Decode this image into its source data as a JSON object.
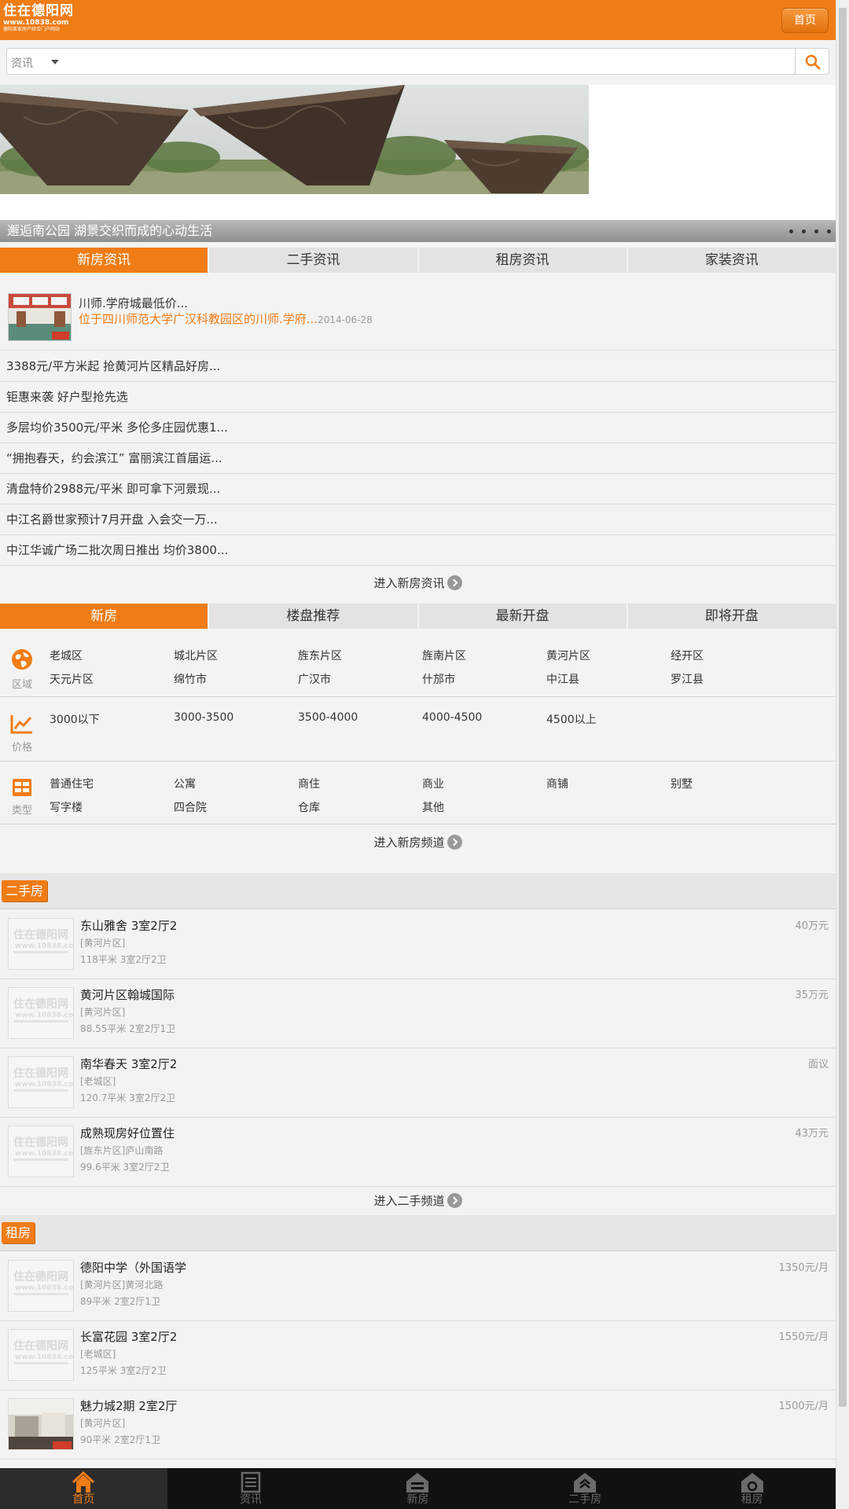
{
  "header": {
    "logo_line1": "住在德阳网",
    "logo_line2": "www.10838.com",
    "logo_line3": "德阳首家房产综合门户网站",
    "home_button": "首页"
  },
  "search": {
    "category": "资讯",
    "placeholder": ""
  },
  "banner": {
    "caption": "邂逅南公园 湖景交织而成的心动生活"
  },
  "news_tabs": [
    "新房资讯",
    "二手资讯",
    "租房资讯",
    "家装资讯"
  ],
  "news": {
    "featured": {
      "title": "川师.学府城最低价...",
      "desc": "位于四川师范大学广汉科教园区的川师.学府...",
      "date": "2014-06-28"
    },
    "items": [
      "3388元/平方米起 抢黄河片区精品好房...",
      "钜惠来袭 好户型抢先选",
      "多层均价3500元/平米 多伦多庄园优惠1...",
      "“拥抱春天，约会滨江” 富丽滨江首届运...",
      "清盘特价2988元/平米 即可拿下河景现...",
      "中江名爵世家预计7月开盘 入会交一万...",
      "中江华诚广场二批次周日推出 均价3800..."
    ],
    "more": "进入新房资讯"
  },
  "house_tabs": [
    "新房",
    "楼盘推荐",
    "最新开盘",
    "即将开盘"
  ],
  "filters": {
    "region": {
      "label": "区域",
      "row1": [
        "老城区",
        "城北片区",
        "旌东片区",
        "旌南片区",
        "黄河片区",
        "经开区"
      ],
      "row2": [
        "天元片区",
        "绵竹市",
        "广汉市",
        "什邡市",
        "中江县",
        "罗江县"
      ]
    },
    "price": {
      "label": "价格",
      "row1": [
        "3000以下",
        "3000-3500",
        "3500-4000",
        "4000-4500",
        "4500以上"
      ]
    },
    "type": {
      "label": "类型",
      "row1": [
        "普通住宅",
        "公寓",
        "商住",
        "商业",
        "商铺",
        "别墅"
      ],
      "row2": [
        "写字楼",
        "四合院",
        "仓库",
        "其他"
      ]
    },
    "more": "进入新房频道"
  },
  "secondhand": {
    "title": "二手房",
    "listings": [
      {
        "title": "东山雅舍 3室2厅2",
        "area": "[黄河片区]",
        "spec": "118平米  3室2厅2卫",
        "price": "40万元"
      },
      {
        "title": "黄河片区翰城国际",
        "area": "[黄河片区]",
        "spec": "88.55平米  2室2厅1卫",
        "price": "35万元"
      },
      {
        "title": "南华春天 3室2厅2",
        "area": "[老城区]",
        "spec": "120.7平米  3室2厅2卫",
        "price": "面议"
      },
      {
        "title": "成熟现房好位置住",
        "area": "[旌东片区]庐山南路",
        "spec": "99.6平米  3室2厅2卫",
        "price": "43万元"
      }
    ],
    "more": "进入二手频道"
  },
  "rental": {
    "title": "租房",
    "listings": [
      {
        "title": "德阳中学（外国语学",
        "area": "[黄河片区]黄河北路",
        "spec": "89平米 2室2厅1卫",
        "price": "1350元/月"
      },
      {
        "title": "长富花园 3室2厅2",
        "area": "[老城区]",
        "spec": "125平米 3室2厅2卫",
        "price": "1550元/月"
      },
      {
        "title": "魅力城2期 2室2厅",
        "area": "[黄河片区]",
        "spec": "90平米 2室2厅1卫",
        "price": "1500元/月"
      }
    ]
  },
  "bottom_nav": [
    "首页",
    "资讯",
    "新房",
    "二手房",
    "租房"
  ],
  "colors": {
    "accent": "#f07c16",
    "nav_bg": "#111111"
  }
}
